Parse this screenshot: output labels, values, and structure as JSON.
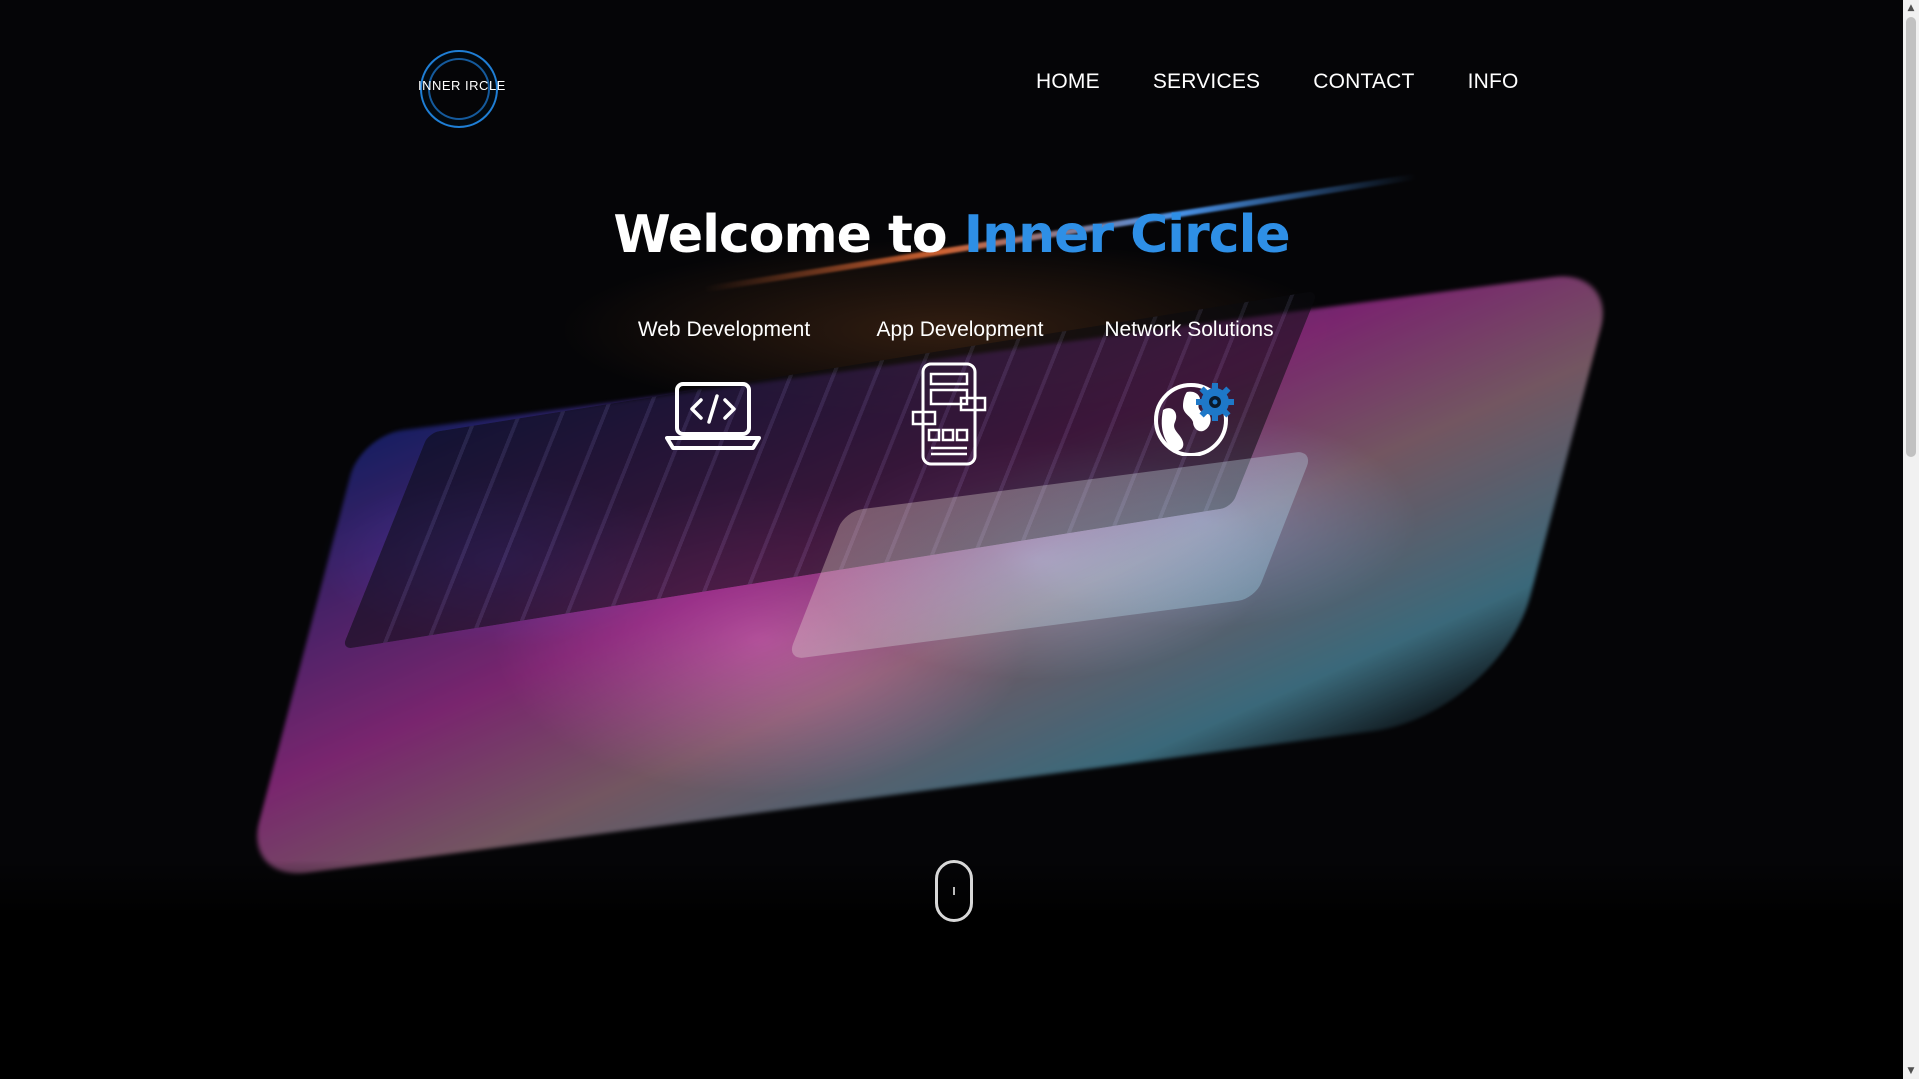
{
  "header": {
    "logo_text": "INNER  IRCLE",
    "nav": [
      {
        "label": "HOME"
      },
      {
        "label": "SERVICES"
      },
      {
        "label": "CONTACT"
      },
      {
        "label": "INFO"
      }
    ]
  },
  "hero": {
    "title_plain": "Welcome to",
    "title_accent": "Inner Circle",
    "services": [
      {
        "label": "Web Development",
        "icon": "laptop-code-icon"
      },
      {
        "label": "App Development",
        "icon": "app-wireframe-icon"
      },
      {
        "label": "Network Solutions",
        "icon": "globe-gear-icon"
      }
    ]
  },
  "colors": {
    "accent": "#2e8fe6",
    "background": "#000000",
    "text": "#ffffff"
  }
}
